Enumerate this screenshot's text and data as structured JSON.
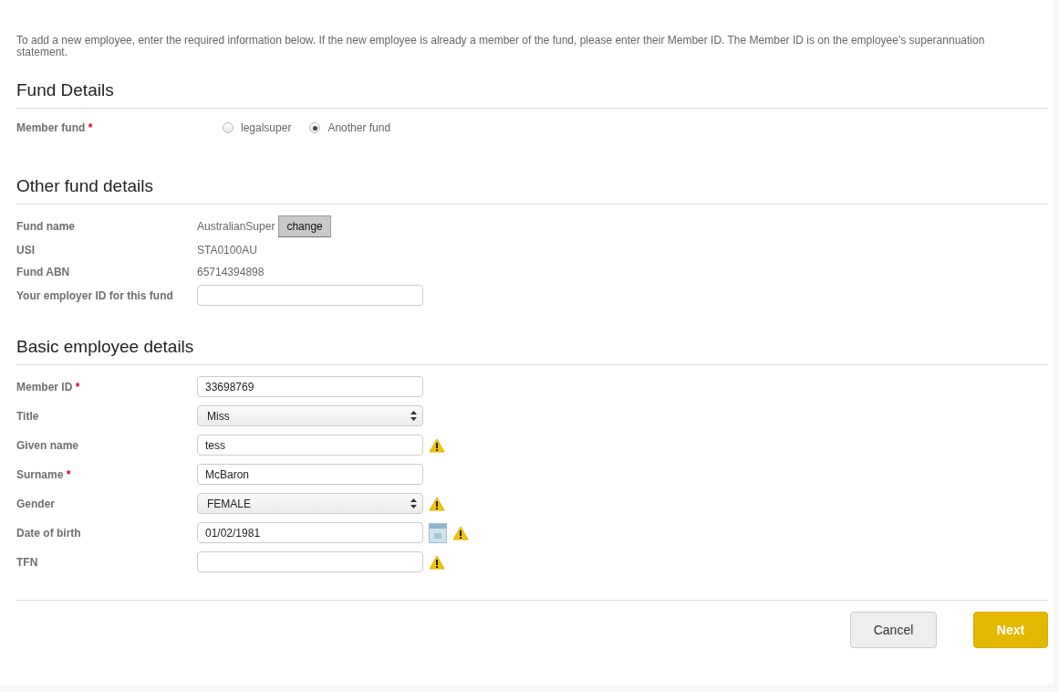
{
  "intro": "To add a new employee, enter the required information below. If the new employee is already a member of the fund, please enter their Member ID. The Member ID is on the employee's superannuation statement.",
  "fund_details": {
    "heading": "Fund Details",
    "label": "Member fund",
    "required_mark": "*",
    "options": [
      {
        "label": "legalsuper",
        "selected": false
      },
      {
        "label": "Another fund",
        "selected": true
      }
    ]
  },
  "other_fund": {
    "heading": "Other fund details",
    "rows": [
      {
        "kind": "text",
        "label": "Fund name",
        "value": "AustralianSuper",
        "button": "change"
      },
      {
        "kind": "text",
        "label": "USI",
        "value": "STA0100AU"
      },
      {
        "kind": "text",
        "label": "Fund ABN",
        "value": "65714394898"
      },
      {
        "kind": "input",
        "label": "Your employer ID for this fund"
      }
    ]
  },
  "employee": {
    "heading": "Basic employee details",
    "rows": [
      {
        "kind": "input",
        "label": "Member ID",
        "required_mark": "*",
        "value": "33698769",
        "warning": false
      },
      {
        "kind": "select",
        "label": "Title",
        "value": "Miss",
        "warning": false
      },
      {
        "kind": "input",
        "label": "Given name",
        "value": "tess",
        "warning": true
      },
      {
        "kind": "input",
        "label": "Surname",
        "required_mark": "*",
        "value": "McBaron",
        "warning": false
      },
      {
        "kind": "select",
        "label": "Gender",
        "value": "FEMALE",
        "warning": true
      },
      {
        "kind": "date",
        "label": "Date of birth",
        "value": "01/02/1981",
        "warning": true
      },
      {
        "kind": "input",
        "label": "TFN",
        "warning": true
      }
    ]
  },
  "buttons": [
    {
      "kind": "secondary",
      "label": "Cancel"
    },
    {
      "kind": "primary",
      "label": "Next"
    }
  ]
}
